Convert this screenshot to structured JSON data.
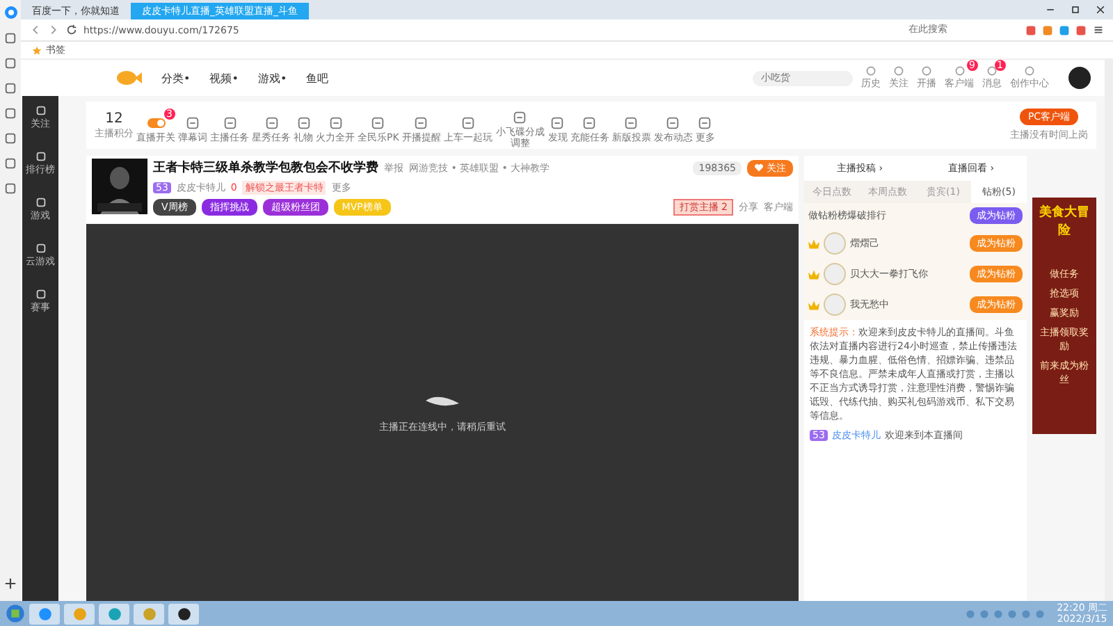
{
  "browser": {
    "tabs": [
      {
        "label": "百度一下，你就知道",
        "selected": false
      },
      {
        "label": "皮皮卡特儿直播_英雄联盟直播_斗鱼",
        "selected": true
      }
    ],
    "url": "https://www.douyu.com/172675",
    "search_placeholder": "在此搜索",
    "bookmarks": [
      "书签"
    ]
  },
  "site_nav": {
    "links": [
      "分类•",
      "视频•",
      "游戏•",
      "鱼吧"
    ],
    "search_placeholder": "小吃货",
    "actions": [
      {
        "label": "历史"
      },
      {
        "label": "关注"
      },
      {
        "label": "开播"
      },
      {
        "label": "客户端",
        "badge": "9"
      },
      {
        "label": "消息",
        "badge": "1"
      },
      {
        "label": "创作中心"
      }
    ]
  },
  "left_nav": [
    {
      "label": "关注"
    },
    {
      "label": "排行榜"
    },
    {
      "label": "游戏"
    },
    {
      "label": "云游戏"
    },
    {
      "label": "赛事"
    }
  ],
  "toolbar": {
    "points": "12",
    "points_label": "主播积分",
    "tools": [
      {
        "label": "直播开关",
        "kind": "switch",
        "badge": "3"
      },
      {
        "label": "弹幕词",
        "kind": "icon"
      },
      {
        "label": "主播任务",
        "kind": "icon"
      },
      {
        "label": "星秀任务",
        "kind": "icon"
      },
      {
        "label": "礼物",
        "kind": "icon"
      },
      {
        "label": "火力全开",
        "kind": "icon"
      },
      {
        "label": "全民乐PK",
        "kind": "icon"
      },
      {
        "label": "开播提醒",
        "kind": "icon"
      },
      {
        "label": "上车一起玩",
        "kind": "icon"
      },
      {
        "label": "小飞碟分成调整",
        "kind": "icon"
      },
      {
        "label": "发现",
        "kind": "icon"
      },
      {
        "label": "充能任务",
        "kind": "icon"
      },
      {
        "label": "新版投票",
        "kind": "icon"
      },
      {
        "label": "发布动态",
        "kind": "icon"
      },
      {
        "label": "更多",
        "kind": "icon"
      }
    ],
    "client_button": "PC客户端",
    "client_note": "主播没有时间上岗"
  },
  "room": {
    "title": "王者卡特三级单杀教学包教包会不收学费",
    "report": "举报",
    "category": "网游竞技 • 英雄联盟 • 大神教学",
    "level": "53",
    "streamer": "皮皮卡特儿",
    "heat": "0",
    "achievement": "解锁之最王者卡特",
    "more": "更多",
    "pills": [
      {
        "label": "V周榜",
        "color": "#444444"
      },
      {
        "label": "指挥挑战",
        "color": "#8a2be2"
      },
      {
        "label": "超级粉丝团",
        "color": "#9b30d9"
      },
      {
        "label": "MVP榜单",
        "color": "#f5c518"
      }
    ],
    "followers": "198365",
    "follow": "关注",
    "tip": "打赏主播",
    "tip_count": "2",
    "share": "分享",
    "client": "客户端"
  },
  "player": {
    "message": "主播正在连线中，请稍后重试"
  },
  "side": {
    "links": [
      "主播投稿 ›",
      "直播回看 ›"
    ],
    "tabs": [
      {
        "label": "今日点数",
        "selected": false
      },
      {
        "label": "本周点数",
        "selected": false
      },
      {
        "label": "贵宾(1)",
        "selected": false
      },
      {
        "label": "钻粉(5)",
        "selected": true
      }
    ],
    "rank_title": "做钻粉榜爆破排行",
    "rank_button": "成为钻粉",
    "ranks": [
      {
        "name": "熠熠己",
        "button": "成为钻粉"
      },
      {
        "name": "贝大大一拳打飞你",
        "button": "成为钻粉"
      },
      {
        "name": "我无愁中",
        "button": "成为钻粉"
      }
    ],
    "system_label": "系统提示：",
    "system_text": "欢迎来到皮皮卡特儿的直播间。斗鱼依法对直播内容进行24小时巡查，禁止传播违法违规、暴力血腥、低俗色情、招嫖诈骗、违禁品等不良信息。严禁未成年人直播或打赏，主播以不正当方式诱导打赏，注意理性消费，警惕诈骗诋毁、代练代抽、购买礼包码游戏币、私下交易等信息。",
    "welcome": {
      "level": "53",
      "user": "皮皮卡特儿",
      "text": "欢迎来到本直播间"
    }
  },
  "ad": {
    "title": "美食大冒险",
    "lines": [
      "做任务",
      "抢选项",
      "赢奖励"
    ],
    "note": "主播领取奖励",
    "cta": "前来成为粉丝"
  },
  "taskbar": {
    "time": "22:20 周二",
    "date": "2022/3/15"
  }
}
